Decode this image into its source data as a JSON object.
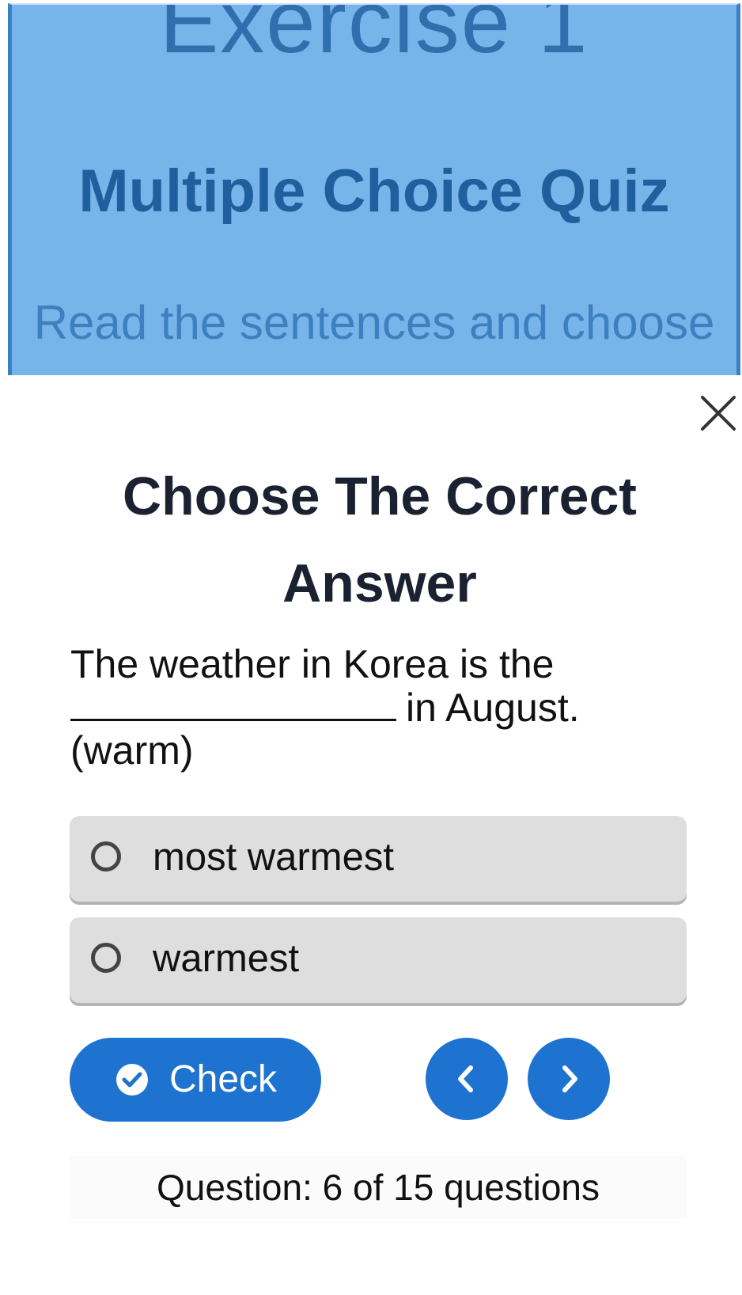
{
  "background": {
    "exercise_heading": "Exercise 1",
    "quiz_title": "Multiple Choice Quiz",
    "description": "Read the sentences and choose the correct"
  },
  "modal": {
    "title": "Choose The Correct Answer",
    "question": {
      "before_blank": "The weather in Korea is the",
      "after_blank": "in August.",
      "hint": "(warm)"
    },
    "options": [
      {
        "label": "most warmest",
        "selected": false
      },
      {
        "label": "warmest",
        "selected": false
      }
    ],
    "check_button_label": "Check",
    "progress_text": "Question: 6 of 15 questions"
  },
  "icons": {
    "close": "close-icon",
    "check": "check-circle-icon",
    "prev": "chevron-left-icon",
    "next": "chevron-right-icon"
  },
  "colors": {
    "accent": "#1e73d0",
    "background_card": "#76b4ea",
    "option_bg": "#dedede",
    "title_text": "#1a2232"
  }
}
